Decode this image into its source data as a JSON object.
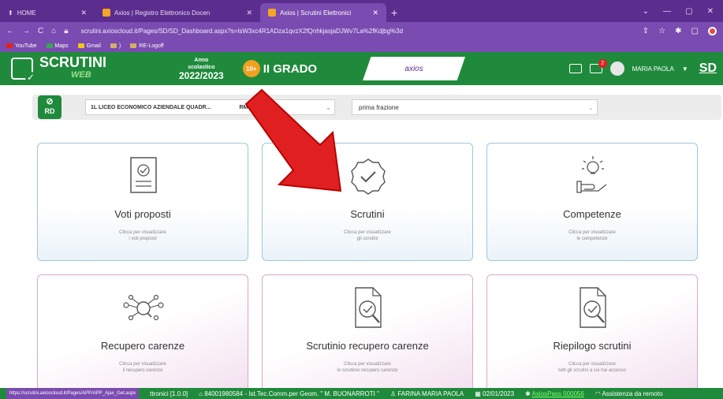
{
  "browser": {
    "tabs": [
      {
        "label": "HOME",
        "active": false
      },
      {
        "label": "Axios | Registro Elettronico Docen",
        "active": false
      },
      {
        "label": "Axios | Scrutini Elettronici",
        "active": true
      }
    ],
    "url": "scrutini.axioscloud.it/Pages/SD/SD_Dashboard.aspx?s=lsW3xc4R1ADza1qvzX2fQnhkjasjaDJWv7La%2fKdjbg%3d",
    "bookmarks": [
      "YouTube",
      "Maps",
      "Gmail",
      "RE-Logoff"
    ]
  },
  "header": {
    "brand": "SCRUTINI",
    "brand_sub": "WEB",
    "year_label_1": "Anno",
    "year_label_2": "scolastico",
    "year": "2022/2023",
    "grado_badge": "10+",
    "grado": "II GRADO",
    "axios_logo": "axios",
    "notifications": "2",
    "user": "MARIA PAOLA",
    "initials": "SD"
  },
  "filters": {
    "logo_text": "RD",
    "class_value": "1L LICEO ECONOMICO AZIENDALE QUADR...",
    "school_code": "RMTD19000N -...",
    "period_value": "prima frazione"
  },
  "cards": [
    {
      "title": "Voti proposti",
      "sub1": "Clicca per visualizzare",
      "sub2": "i voti proposti",
      "icon": "document-check-icon"
    },
    {
      "title": "Scrutini",
      "sub1": "Clicca per visualizzare",
      "sub2": "gli scrutini",
      "icon": "badge-check-icon"
    },
    {
      "title": "Competenze",
      "sub1": "Clicca per visualizzare",
      "sub2": "le competenze",
      "icon": "lightbulb-hand-icon"
    },
    {
      "title": "Recupero carenze",
      "sub1": "Clicca per visualizzare",
      "sub2": "il recupero carenze",
      "icon": "network-search-icon"
    },
    {
      "title": "Scrutinio recupero carenze",
      "sub1": "Clicca per visualizzare",
      "sub2": "lo scrutinio recupero carenze",
      "icon": "document-search-icon"
    },
    {
      "title": "Riepilogo scrutini",
      "sub1": "Clicca per visualizzare",
      "sub2": "tutti gli scrutini a cui hai accesso",
      "icon": "document-search-icon"
    }
  ],
  "statusbar": {
    "link": "https://scrutini.axioscloud.it/Pages/APP/APP_Ajax_Get.aspx",
    "version": "ttronici [1.0.0]",
    "school": "84001980584 - Ist.Tec.Comm.per Geom. \" M. BUONARROTI \"",
    "user": "FARINA MARIA PAOLA",
    "date": "02/01/2023",
    "axiospass": "AxiosPass 000056",
    "assist": "Assistenza da remoto"
  },
  "colors": {
    "browser": "#5b2d8e",
    "app_green": "#1f8a3b",
    "arrow": "#e02020"
  }
}
